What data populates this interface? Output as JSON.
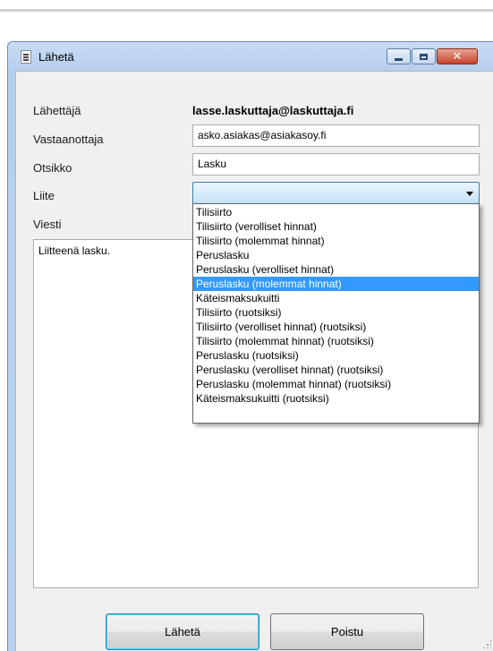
{
  "window": {
    "title": "Lähetä",
    "controls": {
      "minimize": "minimize",
      "maximize": "maximize",
      "close": "✕"
    }
  },
  "form": {
    "sender_label": "Lähettäjä",
    "sender_value": "lasse.laskuttaja@laskuttaja.fi",
    "recipient_label": "Vastaanottaja",
    "recipient_value": "asko.asiakas@asiakasoy.fi",
    "subject_label": "Otsikko",
    "subject_value": "Lasku",
    "attachment_label": "Liite",
    "attachment_value": "",
    "message_label": "Viesti",
    "message_value": "Liitteenä lasku."
  },
  "dropdown": {
    "options": [
      "Tilisiirto",
      "Tilisiirto (verolliset hinnat)",
      "Tilisiirto (molemmat hinnat)",
      "Peruslasku",
      "Peruslasku (verolliset hinnat)",
      "Peruslasku (molemmat hinnat)",
      "Käteismaksukuitti",
      "Tilisiirto (ruotsiksi)",
      "Tilisiirto (verolliset hinnat) (ruotsiksi)",
      "Tilisiirto (molemmat hinnat) (ruotsiksi)",
      "Peruslasku (ruotsiksi)",
      "Peruslasku (verolliset hinnat) (ruotsiksi)",
      "Peruslasku (molemmat hinnat) (ruotsiksi)",
      "Käteismaksukuitti (ruotsiksi)"
    ],
    "highlighted": "Peruslasku (molemmat hinnat)"
  },
  "buttons": {
    "send": "Lähetä",
    "remove": "Poistu"
  },
  "colors": {
    "highlight": "#3399ff",
    "titlebar": "#b9d1ef",
    "close_button": "#c6422a"
  }
}
